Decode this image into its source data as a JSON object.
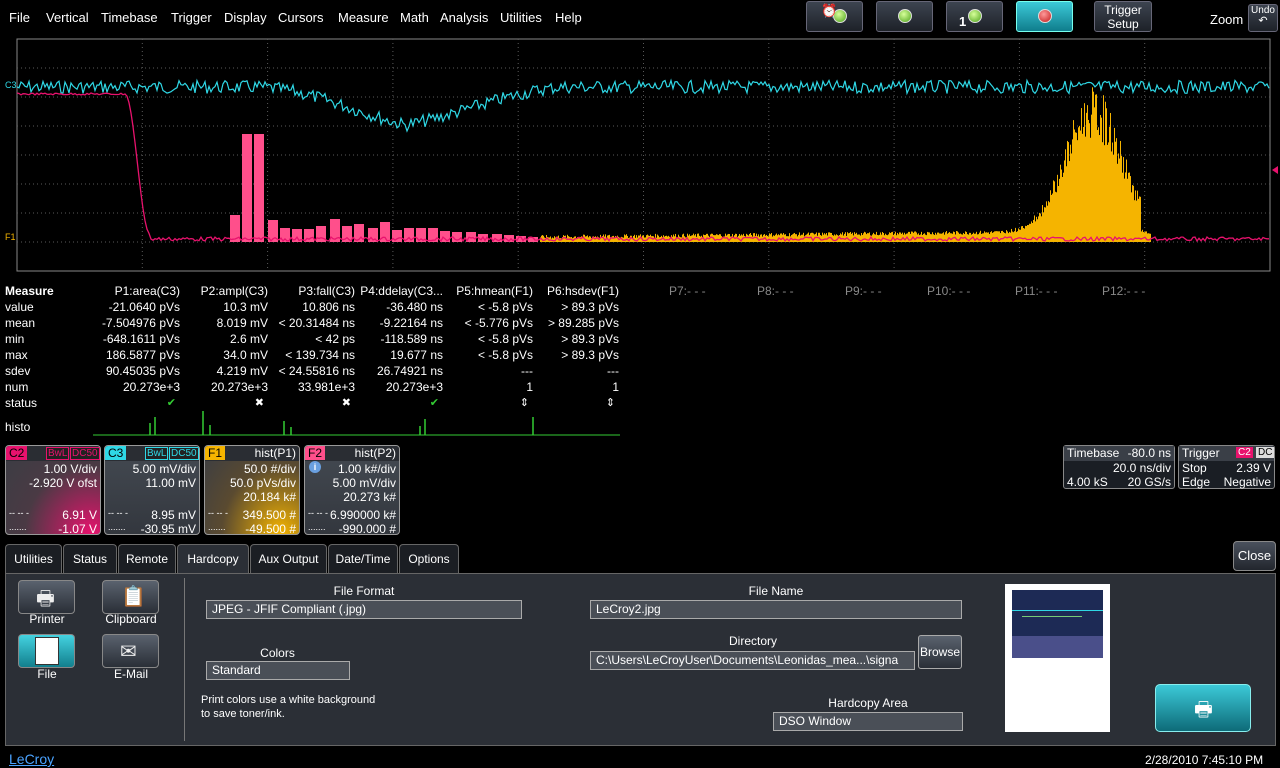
{
  "menu": [
    "File",
    "Vertical",
    "Timebase",
    "Trigger",
    "Display",
    "Cursors",
    "Measure",
    "Math",
    "Analysis",
    "Utilities",
    "Help"
  ],
  "toolbar": {
    "trigger_setup_line1": "Trigger",
    "trigger_setup_line2": "Setup",
    "zoom": "Zoom",
    "undo": "Undo",
    "single_count": "1"
  },
  "grid_labels": {
    "c3": "C3",
    "f1": "F1"
  },
  "measure": {
    "title": "Measure",
    "rows": [
      "value",
      "mean",
      "min",
      "max",
      "sdev",
      "num",
      "status",
      "histo"
    ],
    "params": [
      {
        "name": "P1:area(C3)",
        "values": [
          "-21.0640 pVs",
          "-7.504976 pVs",
          "-648.1611 pVs",
          "186.5877 pVs",
          "90.45035 pVs",
          "20.273e+3"
        ],
        "status": "✔"
      },
      {
        "name": "P2:ampl(C3)",
        "values": [
          "10.3 mV",
          "8.019 mV",
          "2.6 mV",
          "34.0 mV",
          "4.219 mV",
          "20.273e+3"
        ],
        "status": "✖"
      },
      {
        "name": "P3:fall(C3)",
        "values": [
          "10.806 ns",
          "< 20.31484 ns",
          "< 42 ps",
          "< 139.734 ns",
          "< 24.55816 ns",
          "33.981e+3"
        ],
        "status": "✖"
      },
      {
        "name": "P4:ddelay(C3...",
        "values": [
          "-36.480 ns",
          "-9.22164 ns",
          "-118.589 ns",
          "19.677 ns",
          "26.74921 ns",
          "20.273e+3"
        ],
        "status": "✔"
      },
      {
        "name": "P5:hmean(F1)",
        "values": [
          "< -5.8 pVs",
          "< -5.776 pVs",
          "< -5.8 pVs",
          "< -5.8 pVs",
          "---",
          "1"
        ],
        "status": "⇕"
      },
      {
        "name": "P6:hsdev(F1)",
        "values": [
          "> 89.3 pVs",
          "> 89.285 pVs",
          "> 89.3 pVs",
          "> 89.3 pVs",
          "---",
          "1"
        ],
        "status": "⇕"
      }
    ],
    "unused": [
      "P7:- - -",
      "P8:- - -",
      "P9:- - -",
      "P10:- - -",
      "P11:- - -",
      "P12:- - -"
    ]
  },
  "traces": [
    {
      "tag": "C2",
      "color": "#e8126d",
      "badges": [
        "BwL",
        "DC50"
      ],
      "line1": "1.00 V/div",
      "line2": "-2.920 V ofst",
      "line3": "",
      "top": "6.91 V",
      "bottom": "-1.07 V"
    },
    {
      "tag": "C3",
      "color": "#2fd8e6",
      "badges": [
        "BwL",
        "DC50"
      ],
      "line1": "5.00 mV/div",
      "line2": "11.00 mV",
      "line3": "",
      "top": "8.95 mV",
      "bottom": "-30.95 mV"
    },
    {
      "tag": "F1",
      "color": "#f5b400",
      "badges": [
        "hist(P1)"
      ],
      "line1": "50.0 #/div",
      "line2": "50.0 pVs/div",
      "line3": "20.184 k#",
      "top": "349.500 #",
      "bottom": "-49.500 #"
    },
    {
      "tag": "F2",
      "color": "#ff4f8b",
      "badges": [
        "hist(P2)"
      ],
      "line1": "1.00 k#/div",
      "line2": "5.00 mV/div",
      "line3": "20.273 k#",
      "top": "6.990000 k#",
      "bottom": "-990.000 #"
    }
  ],
  "timebase": {
    "label": "Timebase",
    "delay": "-80.0 ns",
    "div": "20.0 ns/div",
    "samples": "4.00 kS",
    "rate": "20 GS/s"
  },
  "trigger": {
    "label": "Trigger",
    "src": "C2",
    "coupling": "DC",
    "mode": "Stop",
    "level": "2.39 V",
    "type": "Edge",
    "slope": "Negative"
  },
  "tabs": [
    "Utilities",
    "Status",
    "Remote",
    "Hardcopy",
    "Aux Output",
    "Date/Time",
    "Options"
  ],
  "active_tab": "Hardcopy",
  "close": "Close",
  "hardcopy": {
    "printer": "Printer",
    "clipboard": "Clipboard",
    "file": "File",
    "email": "E-Mail",
    "file_format_label": "File Format",
    "file_format": "JPEG - JFIF Compliant (.jpg)",
    "colors_label": "Colors",
    "colors": "Standard",
    "note": "Print colors use a white background\nto save toner/ink.",
    "file_name_label": "File Name",
    "file_name": "LeCroy2.jpg",
    "directory_label": "Directory",
    "directory": "C:\\Users\\LeCroyUser\\Documents\\Leonidas_mea...\\signa",
    "browse": "Browse",
    "area_label": "Hardcopy Area",
    "area": "DSO Window"
  },
  "footer": {
    "logo": "LeCroy",
    "datetime": "2/28/2010 7:45:10 PM"
  },
  "colors": {
    "c2": "#e8126d",
    "c3": "#2fd8e6",
    "f1": "#f5b400",
    "f2": "#ff4f8b",
    "active": "#2bc0cf"
  }
}
